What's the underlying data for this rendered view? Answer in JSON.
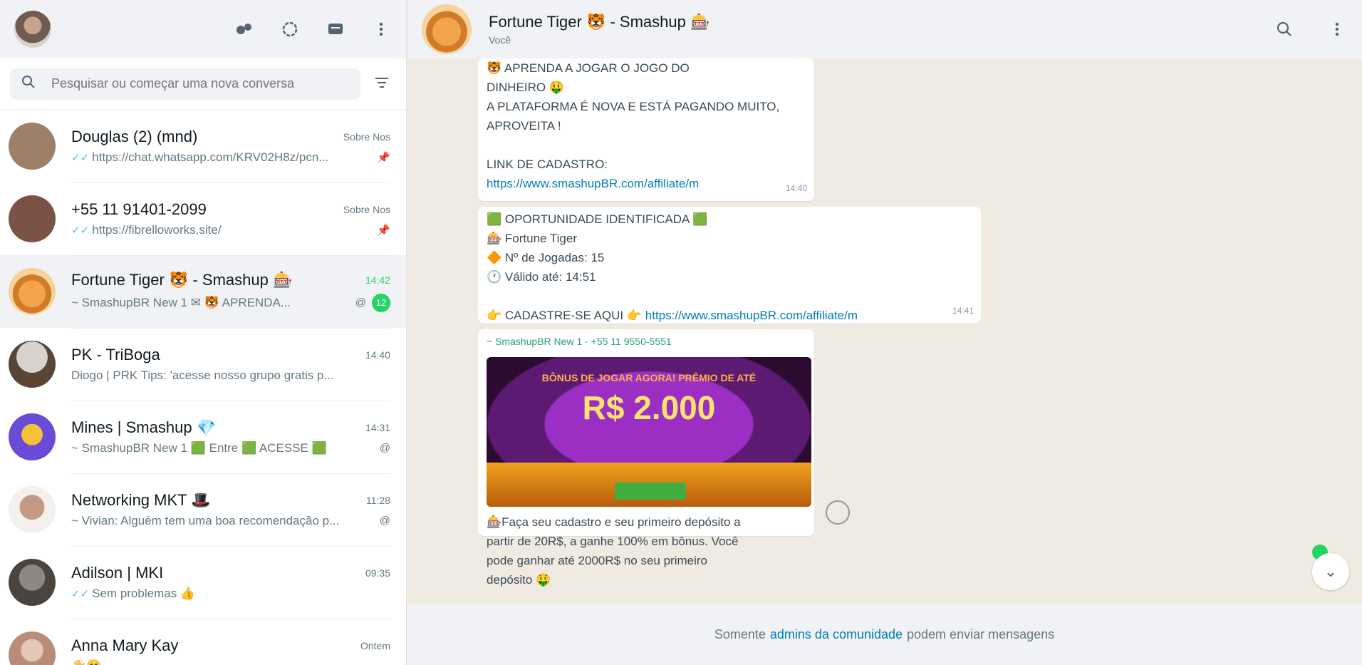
{
  "sidebar": {
    "search": {
      "placeholder": "Pesquisar ou começar uma nova conversa"
    },
    "header_icons": [
      "communities-icon",
      "status-icon",
      "new-chat-icon",
      "menu-icon"
    ],
    "chats": [
      {
        "name": "Douglas (2) (mnd)",
        "time": "Sobre Nos",
        "preview": "https://chat.whatsapp.com/KRV02H8z/pcn...",
        "avatar": "#9e7f6a"
      },
      {
        "name": "+55 11 91401-2099",
        "time": "Sobre Nos",
        "preview": "https://fibrelloworks.site/",
        "avatar": "#7b5246"
      },
      {
        "name": "Fortune Tiger 🐯 - Smashup 🎰",
        "time": "14:42",
        "preview": "~ SmashupBR New 1 ✉ 🐯 APRENDA...",
        "badge": "12",
        "avatar": "#e38d3c",
        "active": true
      },
      {
        "name": "PK - TriBoga",
        "time": "14:40",
        "preview": "Diogo | PRK Tips: 'acesse nosso grupo gratis p...",
        "avatar": "#5a4436"
      },
      {
        "name": "Mines | Smashup 💎",
        "time": "14:31",
        "preview": "~ SmashupBR New 1 🟩 Entre 🟩 ACESSE 🟩",
        "avatar": "#6a4bd6"
      },
      {
        "name": "Networking MKT 🎩",
        "time": "11:28",
        "preview": "~ Vivian: Alguém tem uma boa recomendação p...",
        "avatar": "#c49a86"
      },
      {
        "name": "Adilson | MKI",
        "time": "09:35",
        "preview": "Sem problemas 👍",
        "avatar": "#6b6360"
      },
      {
        "name": "Anna Mary Kay",
        "time": "Ontem",
        "preview": "👋😊",
        "avatar": "#b88c78"
      }
    ]
  },
  "chat": {
    "title": "Fortune Tiger 🐯 - Smashup 🎰",
    "subtitle": "Você",
    "bubble1": {
      "lines": [
        "🐯 APRENDA A JOGAR O JOGO DO",
        "DINHEIRO 🤑",
        "A PLATAFORMA É NOVA E ESTÁ PAGANDO MUITO,",
        "APROVEITA !",
        "",
        "LINK DE CADASTRO:"
      ],
      "link": "https://www.smashupBR.com/affiliate/m",
      "time": "14:40"
    },
    "bubble2": {
      "lines": [
        "🟩 OPORTUNIDADE IDENTIFICADA 🟩",
        "🎰 Fortune Tiger",
        "🔶 Nº de Jogadas: 15",
        "🕐 Válido até: 14:51",
        ""
      ],
      "last_prefix": "👉 CADASTRE-SE AQUI 👉",
      "link": "https://www.smashupBR.com/affiliate/m",
      "time": "14:41"
    },
    "bubble3": {
      "sender": "~ SmashupBR New 1 · +55 11 9550-5551",
      "promo_title": "BÔNUS DE JOGAR AGORA! PRÊMIO DE ATÉ",
      "promo_amount": "R$ 2.000",
      "caption": [
        "🎰Faça seu cadastro e seu primeiro depósito a",
        "partir de 20R$, a ganhe 100% em bônus. Você",
        "pode ganhar até 2000R$ no seu primeiro",
        "depósito 🤑"
      ]
    },
    "footer": {
      "prefix": "Somente",
      "link": "admins da comunidade",
      "suffix": "podem enviar mensagens"
    }
  }
}
